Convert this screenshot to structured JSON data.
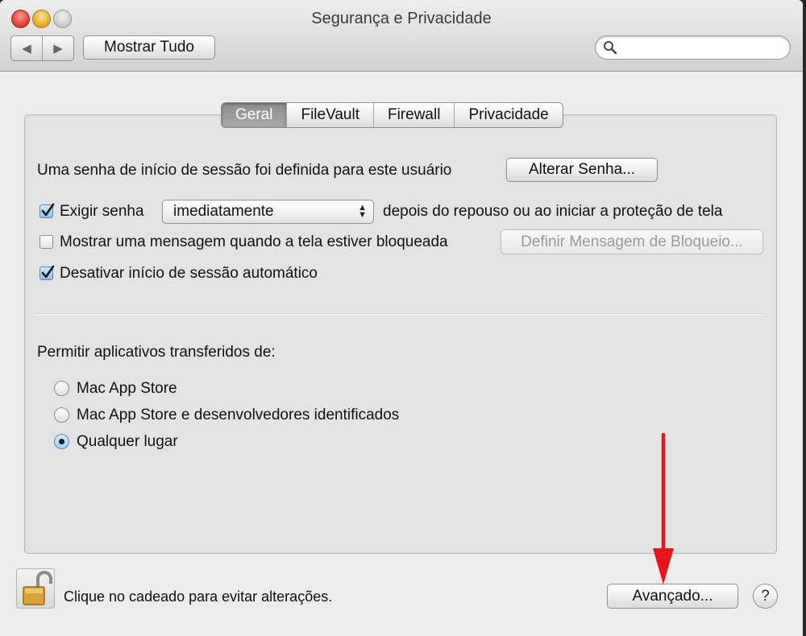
{
  "window": {
    "title": "Segurança e Privacidade"
  },
  "toolbar": {
    "back_icon": "◀",
    "forward_icon": "▶",
    "show_all_label": "Mostrar Tudo",
    "search_placeholder": "",
    "search_value": ""
  },
  "tabs": [
    {
      "label": "Geral",
      "active": true
    },
    {
      "label": "FileVault",
      "active": false
    },
    {
      "label": "Firewall",
      "active": false
    },
    {
      "label": "Privacidade",
      "active": false
    }
  ],
  "general": {
    "password_set_text": "Uma senha de início de sessão foi definida para este usuário",
    "change_password_label": "Alterar Senha...",
    "require_password": {
      "checked": true,
      "label": "Exigir senha",
      "popup_value": "imediatamente",
      "suffix": "depois do repouso ou ao iniciar a proteção de tela"
    },
    "show_message": {
      "checked": false,
      "label": "Mostrar uma mensagem quando a tela estiver bloqueada",
      "button_label": "Definir Mensagem de Bloqueio..."
    },
    "disable_auto_login": {
      "checked": true,
      "label": "Desativar início de sessão automático"
    },
    "allow_apps_heading": "Permitir aplicativos transferidos de:",
    "allow_apps_options": [
      {
        "label": "Mac App Store",
        "selected": false
      },
      {
        "label": "Mac App Store e desenvolvedores identificados",
        "selected": false
      },
      {
        "label": "Qualquer lugar",
        "selected": true
      }
    ]
  },
  "footer": {
    "lock_text": "Clique no cadeado para evitar alterações.",
    "advanced_label": "Avançado...",
    "help_label": "?"
  },
  "colors": {
    "annotation_arrow": "#e8161b",
    "selection_blue": "#8fc0f2"
  }
}
